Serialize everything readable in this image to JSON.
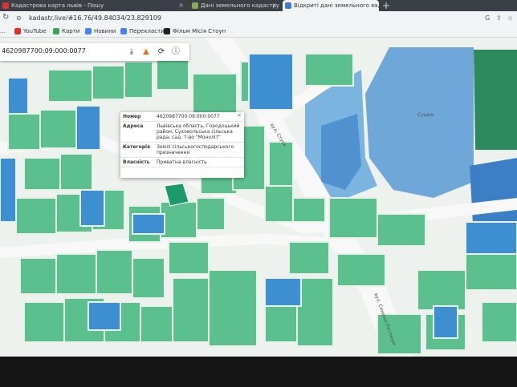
{
  "tabs": [
    {
      "label": "Кадастрова карта львів - Пошу"
    },
    {
      "label": "Дані земельного кадастру"
    },
    {
      "label": "Відкриті дані земельного кад"
    }
  ],
  "address": {
    "url": "kadastr.live/#16.76/49.84034/23.829109"
  },
  "bookmarks": [
    {
      "label": "YouTube",
      "color": "#e52d27"
    },
    {
      "label": "Карти",
      "color": "#34a853"
    },
    {
      "label": "Новини",
      "color": "#4285f4"
    },
    {
      "label": "Перекласти",
      "color": "#4285f4"
    },
    {
      "label": "Фільм Місія Стоун",
      "color": "#222222"
    }
  ],
  "toolbar": {
    "cadastral_number": "4620987700:09:000:0077",
    "download_icon": "download-icon",
    "warning_icon": "warning-icon",
    "refresh_icon": "refresh-icon",
    "info_icon": "info-icon"
  },
  "popup": {
    "rows": [
      {
        "key": "Номер",
        "value": "4620987700:09:000:0077"
      },
      {
        "key": "Адреса",
        "value": "Львівська область, Городоцький район, Суховольська сільська рада, сад. т-во \"Моноліт\""
      },
      {
        "key": "Категорія",
        "value": "Землі сільськогосподарського призначення"
      },
      {
        "key": "Власність",
        "value": "Приватна власність"
      }
    ],
    "close": "×"
  },
  "labels": {
    "road1": "вул. Стуса",
    "road2": "вул. Симона Петлюри",
    "water": "Сушки"
  },
  "colors": {
    "parcel_green": "#5cc08e",
    "parcel_blue": "#3d8fd1",
    "selected": "#1c9a6c",
    "road": "#f4f6f4"
  }
}
